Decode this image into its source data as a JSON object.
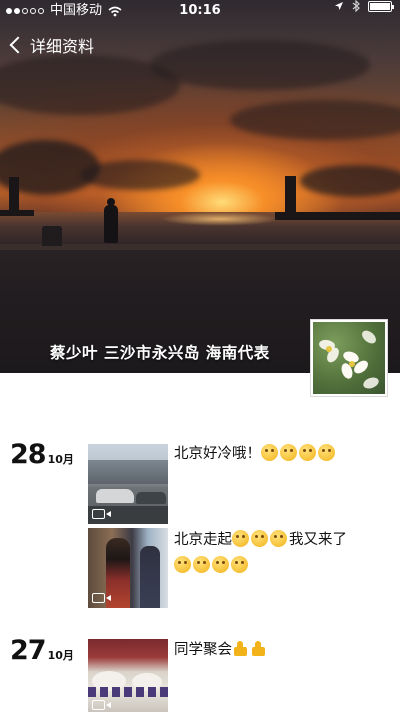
{
  "status_bar": {
    "carrier": "中国移动",
    "time": "10:16"
  },
  "nav": {
    "back_label": "详细资料"
  },
  "profile": {
    "name": "蔡少叶 三沙市永兴岛 海南代表"
  },
  "feed": [
    {
      "day": "28",
      "month": "10月",
      "posts": [
        {
          "text": "北京好冷哦！",
          "emoji": [
            "emoji",
            "emoji",
            "emoji",
            "emoji"
          ]
        },
        {
          "text": "北京走起",
          "text_after": "我又来了"
        }
      ]
    },
    {
      "day": "27",
      "month": "10月",
      "posts": [
        {
          "text": "同学聚会"
        }
      ]
    }
  ]
}
